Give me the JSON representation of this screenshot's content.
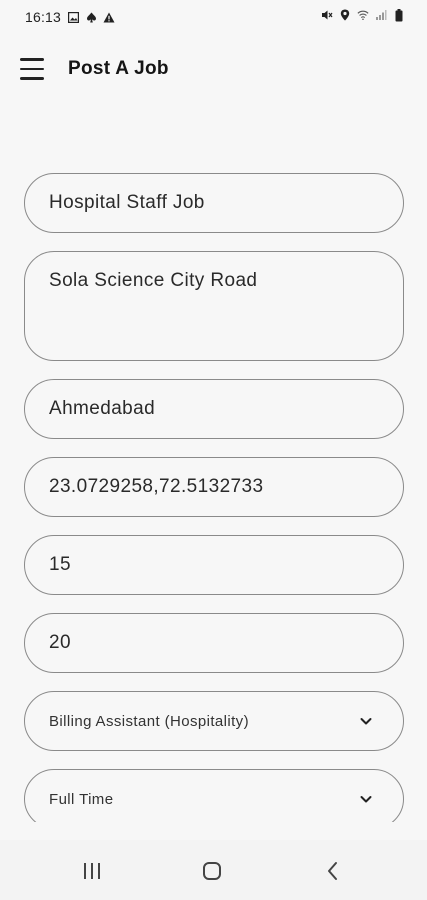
{
  "status_bar": {
    "time": "16:13",
    "left_icons": [
      "image-icon",
      "spade-icon",
      "warning-icon"
    ],
    "right_icons": [
      "mute-icon",
      "location-icon",
      "wifi-icon",
      "signal-icon",
      "battery-icon"
    ]
  },
  "app_bar": {
    "title": "Post A Job"
  },
  "form": {
    "job_title": "Hospital Staff Job",
    "address": "Sola Science City Road",
    "city": "Ahmedabad",
    "coordinates": "23.0729258,72.5132733",
    "field_five": "15",
    "field_six": "20",
    "category_selected": "Billing Assistant (Hospitality)",
    "job_type_selected": "Full Time"
  },
  "nav_bar": {
    "buttons": [
      "recent-apps",
      "home",
      "back"
    ]
  }
}
